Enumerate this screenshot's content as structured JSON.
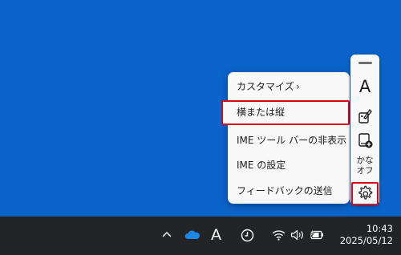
{
  "ime_menu": {
    "items": [
      {
        "label": "カスタマイズ",
        "has_submenu": true,
        "chevron": "›"
      },
      {
        "label": "横または縦",
        "highlighted": true
      },
      {
        "label": "IME ツール バーの非表示"
      },
      {
        "label": "IME の設定"
      },
      {
        "label": "フィードバックの送信"
      }
    ]
  },
  "ime_toolbar": {
    "input_mode": "A",
    "kana_label_line1": "かな",
    "kana_label_line2": "オフ",
    "icons": [
      "drag-grip-icon",
      "input-mode-icon",
      "ime-pad-icon",
      "dictionary-add-icon",
      "settings-gear-icon"
    ]
  },
  "taskbar": {
    "ime_indicator": "A",
    "time": "10:43",
    "date": "2025/05/12",
    "tray_icons": [
      "chevron-up-icon",
      "onedrive-cloud-icon",
      "ime-mode-icon",
      "clock-app-icon",
      "wifi-icon",
      "speaker-icon",
      "battery-charging-icon"
    ]
  },
  "colors": {
    "desktop": "#0a63c9",
    "taskbar": "#222426",
    "highlight_border": "#e0001a",
    "menu_bg": "#f9f9f9"
  }
}
